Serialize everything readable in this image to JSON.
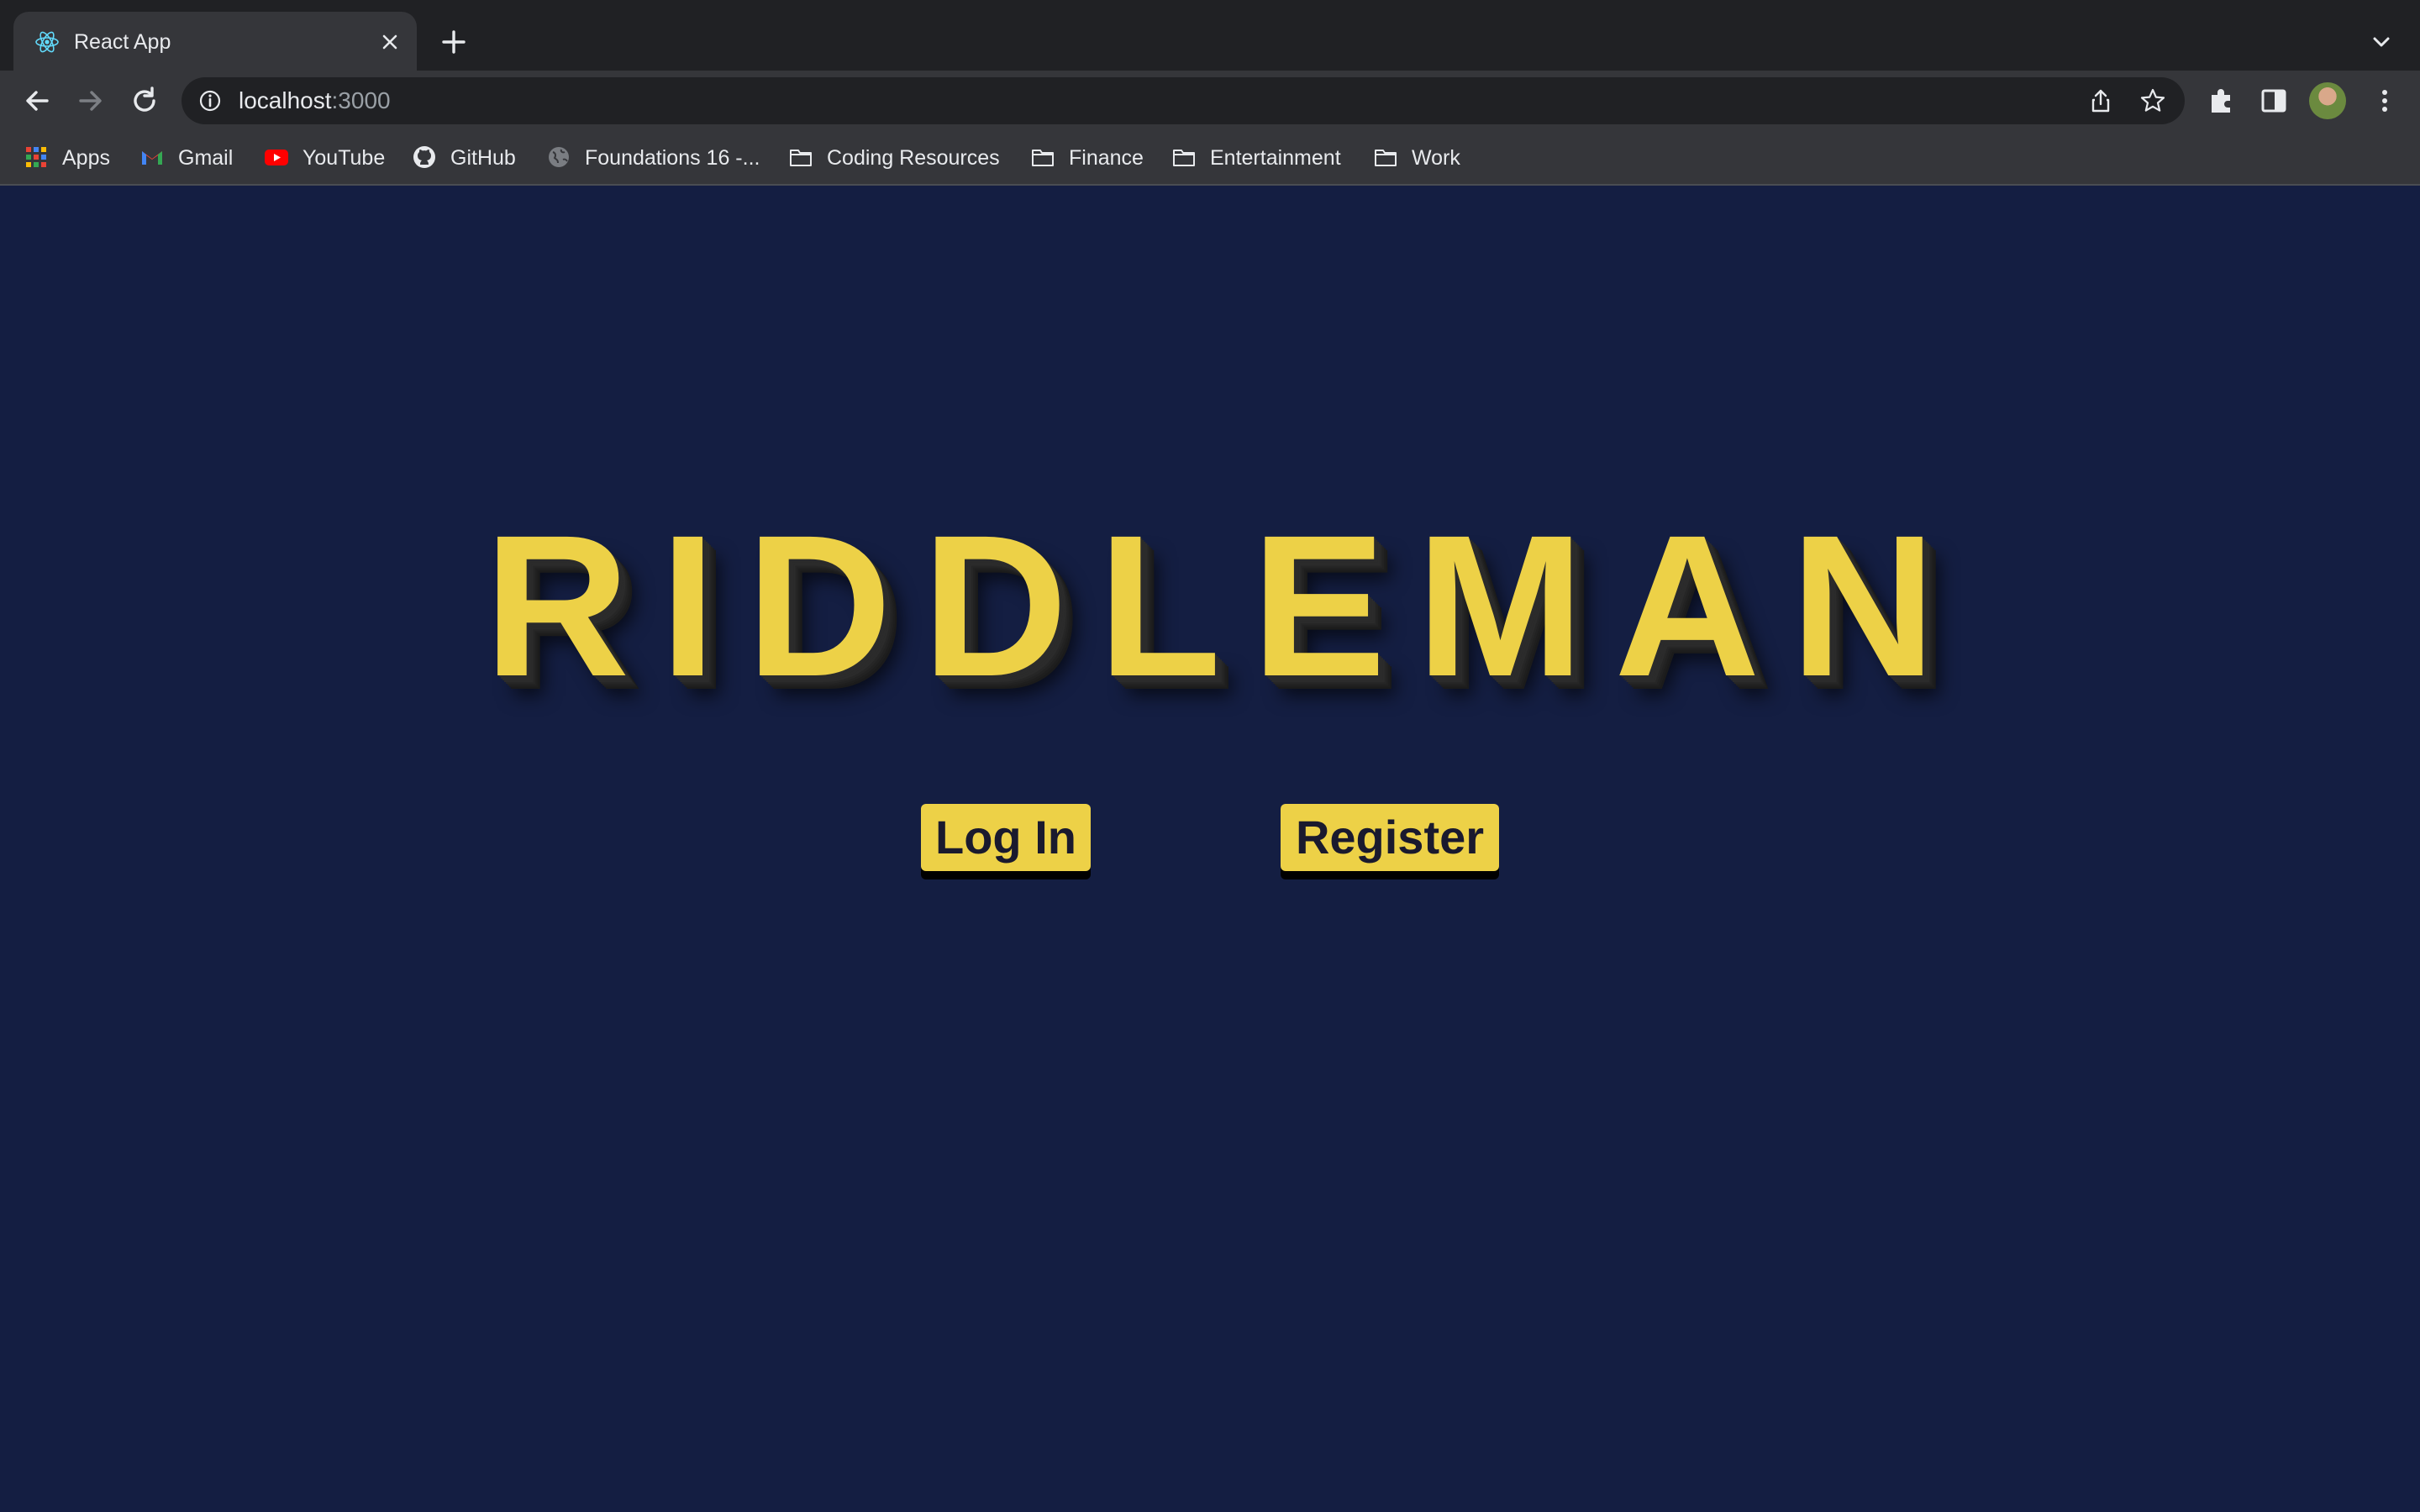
{
  "browser": {
    "tab": {
      "title": "React App",
      "favicon": "react-icon"
    },
    "address": {
      "host": "localhost",
      "port": ":3000"
    },
    "bookmarks": [
      {
        "label": "Apps",
        "icon": "apps-grid-icon"
      },
      {
        "label": "Gmail",
        "icon": "gmail-icon"
      },
      {
        "label": "YouTube",
        "icon": "youtube-icon"
      },
      {
        "label": "GitHub",
        "icon": "github-icon"
      },
      {
        "label": "Foundations 16 -...",
        "icon": "globe-icon"
      },
      {
        "label": "Coding Resources",
        "icon": "folder-icon"
      },
      {
        "label": "Finance",
        "icon": "folder-icon"
      },
      {
        "label": "Entertainment",
        "icon": "folder-icon"
      },
      {
        "label": "Work",
        "icon": "folder-icon"
      }
    ]
  },
  "page": {
    "logo": "RIDDLEMAN",
    "buttons": {
      "login": "Log In",
      "register": "Register"
    },
    "colors": {
      "background": "#141e42",
      "accent": "#edd147"
    }
  }
}
